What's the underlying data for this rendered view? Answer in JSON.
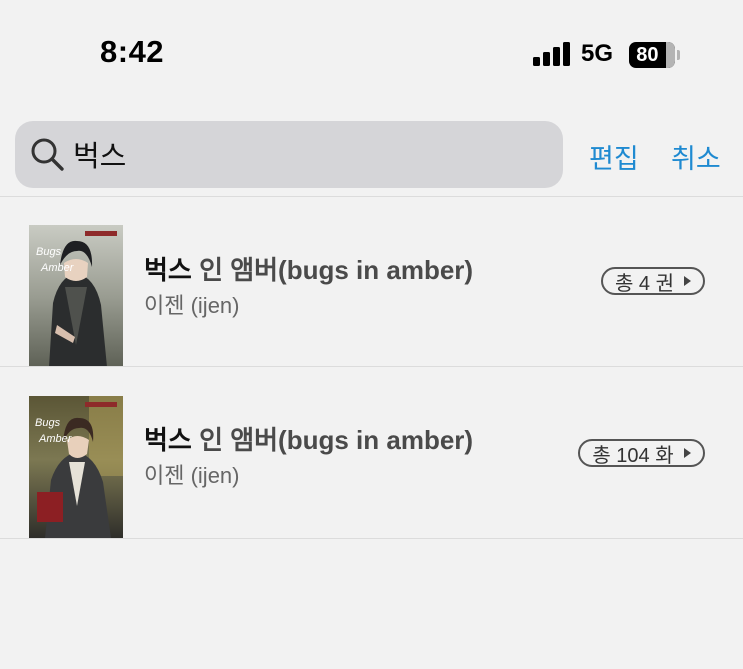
{
  "status_bar": {
    "time": "8:42",
    "network": "5G",
    "battery": "80",
    "battery_level": 0.8
  },
  "search": {
    "query": "벅스",
    "edit_label": "편집",
    "cancel_label": "취소"
  },
  "results": [
    {
      "title_highlight": "벅스",
      "title_rest": " 인 앰버(bugs in amber)",
      "author": "이젠 (ijen)",
      "badge": "총 4 권"
    },
    {
      "title_highlight": "벅스",
      "title_rest": " 인 앰버(bugs in amber)",
      "author": "이젠 (ijen)",
      "badge": "총 104 화"
    }
  ],
  "colors": {
    "accent": "#1f8ad1",
    "background": "#f2f2f2",
    "search_bg": "#d5d5d8"
  }
}
